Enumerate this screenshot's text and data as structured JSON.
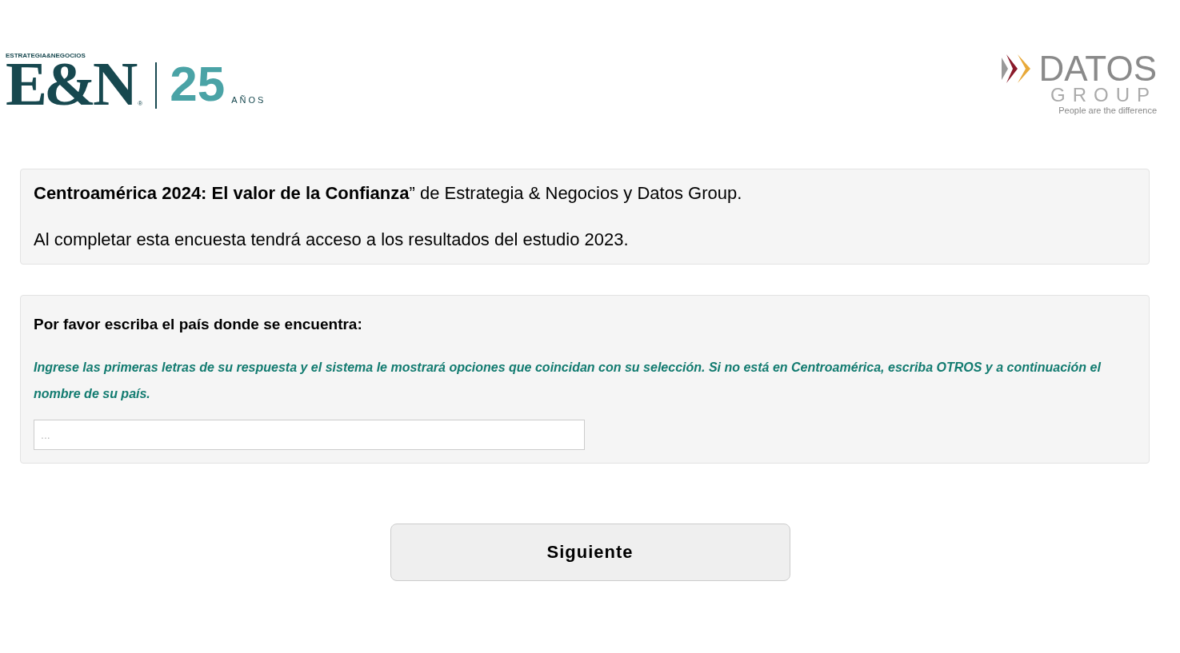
{
  "header": {
    "left_logo": {
      "tagline": "ESTRATEGIA&NEGOCIOS",
      "wordmark": "E&N",
      "registered": "®",
      "anniversary": "25",
      "anniversary_label": "AÑOS"
    },
    "right_logo": {
      "wordmark": "DATOS",
      "subword": "GROUP",
      "slogan": "People are the difference"
    }
  },
  "intro": {
    "paragraphs": [
      "**Centroamérica 2024: El valor de la Confianza**” de Estrategia & Negocios y Datos Group.",
      "Al completar esta encuesta tendrá acceso a los resultados del estudio 2023."
    ]
  },
  "question": {
    "title": "Por favor escriba el país donde se encuentra:",
    "help": "Ingrese las primeras letras de su respuesta y el sistema le mostrará opciones que coincidan con su selección. Si no está en Centroamérica, escriba OTROS y a continuación el nombre de su país.",
    "placeholder": "..."
  },
  "buttons": [
    "Siguiente"
  ]
}
